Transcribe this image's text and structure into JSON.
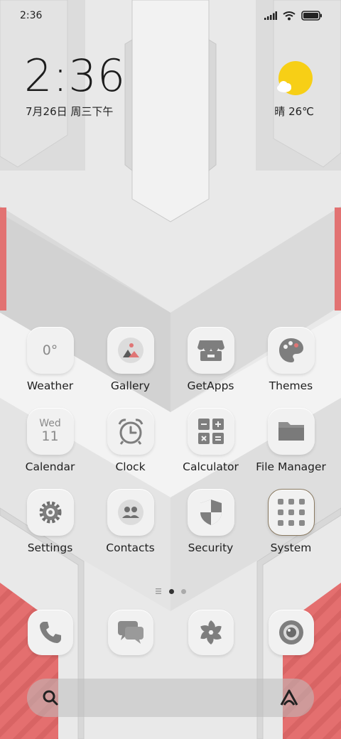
{
  "status_bar": {
    "time": "2:36"
  },
  "lockclock": {
    "time": "2:36",
    "date": "7月26日 周三下午"
  },
  "weather": {
    "text": "晴 26℃"
  },
  "apps": [
    {
      "label": "Weather",
      "icon": "weather-icon",
      "icon_text": "0°"
    },
    {
      "label": "Gallery",
      "icon": "gallery-icon"
    },
    {
      "label": "GetApps",
      "icon": "store-icon"
    },
    {
      "label": "Themes",
      "icon": "palette-icon"
    },
    {
      "label": "Calendar",
      "icon": "calendar-icon",
      "day_name": "Wed",
      "day_num": "11"
    },
    {
      "label": "Clock",
      "icon": "alarm-clock-icon"
    },
    {
      "label": "Calculator",
      "icon": "calculator-icon"
    },
    {
      "label": "File Manager",
      "icon": "folder-icon"
    },
    {
      "label": "Settings",
      "icon": "gear-icon"
    },
    {
      "label": "Contacts",
      "icon": "contacts-icon"
    },
    {
      "label": "Security",
      "icon": "shield-icon"
    },
    {
      "label": "System",
      "icon": "folder-grid-icon"
    }
  ],
  "dock": [
    {
      "name": "phone",
      "icon": "phone-icon"
    },
    {
      "name": "messages",
      "icon": "message-icon"
    },
    {
      "name": "browser",
      "icon": "aperture-icon"
    },
    {
      "name": "camera",
      "icon": "camera-icon"
    }
  ],
  "colors": {
    "accent_red": "#e07575",
    "weather_sun": "#f7cf16",
    "icon_gray": "#7e7e7e"
  }
}
